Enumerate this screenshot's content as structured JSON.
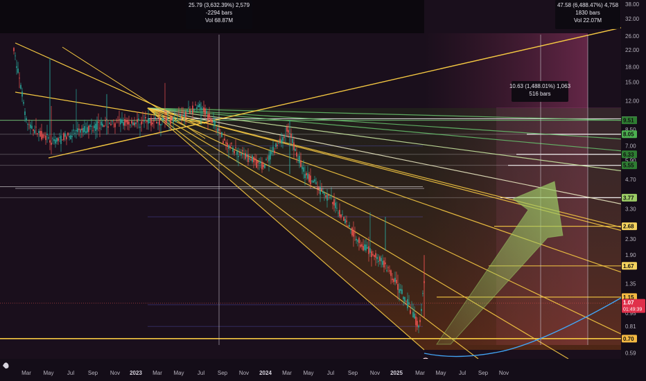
{
  "chart_data": {
    "type": "candlestick",
    "y_scale": "log",
    "ylim": [
      0.55,
      40
    ],
    "grid": false,
    "x_tick_labels": [
      "Mar",
      "May",
      "Jul",
      "Sep",
      "Nov",
      "2023",
      "Mar",
      "May",
      "Jul",
      "Sep",
      "Nov",
      "2024",
      "Mar",
      "May",
      "Jul",
      "Sep",
      "Nov",
      "2025",
      "Mar",
      "May",
      "Jul",
      "Sep",
      "Nov"
    ],
    "x_tick_bold": [
      "2023",
      "2024",
      "2025"
    ],
    "y_tick_labels": [
      "38.00",
      "32.00",
      "26.00",
      "22.00",
      "18.00",
      "15.00",
      "12.00",
      "9.52",
      "9.51",
      "8.50",
      "8.05",
      "7.00",
      "6.33",
      "5.90",
      "5.55",
      "4.70",
      "3.77",
      "3.30",
      "2.68",
      "2.30",
      "1.90",
      "1.67",
      "1.35",
      "1.15",
      "1.07",
      "0.95",
      "0.81",
      "0.70",
      "0.59"
    ],
    "y_tick_values": [
      38,
      32,
      26,
      22,
      18,
      15,
      12,
      9.52,
      9.51,
      8.5,
      8.05,
      7,
      6.33,
      5.9,
      5.55,
      4.7,
      3.77,
      3.3,
      2.68,
      2.3,
      1.9,
      1.67,
      1.35,
      1.15,
      1.07,
      0.95,
      0.81,
      0.7,
      0.59
    ],
    "marked_levels": [
      {
        "label": "9.52",
        "value": 9.52,
        "bg": "#ffffff"
      },
      {
        "label": "9.51",
        "value": 9.51,
        "bg": "#2e7d32"
      },
      {
        "label": "8.05",
        "value": 8.05,
        "bg": "#4caf50"
      },
      {
        "label": "6.33",
        "value": 6.33,
        "bg": "#2e7d32"
      },
      {
        "label": "5.55",
        "value": 5.55,
        "bg": "#2e7d32"
      },
      {
        "label": "3.77",
        "value": 3.77,
        "bg": "#9ccc65"
      },
      {
        "label": "2.68",
        "value": 2.68,
        "bg": "#f4d35e"
      },
      {
        "label": "1.67",
        "value": 1.67,
        "bg": "#f4d35e"
      },
      {
        "label": "1.15",
        "value": 1.15,
        "bg": "#f4b942"
      },
      {
        "label": "0.70",
        "value": 0.7,
        "bg": "#f4b942"
      }
    ],
    "last_price": {
      "value": "1.07",
      "countdown": "01:49:39",
      "bg": "#e0304a"
    },
    "measurements": [
      {
        "line1": "25.79 (3,632.39%) 2,579",
        "line2": "-2294 bars",
        "line3": "Vol 68.87M"
      },
      {
        "line1": "47.58 (6,488.47%) 4,758",
        "line2": "1830 bars",
        "line3": "Vol 22.07M"
      },
      {
        "line1": "10.63 (1,488.01%) 1,063",
        "line2": "516 bars",
        "line3": ""
      }
    ],
    "colors": {
      "background": "#140d18",
      "up": "#26a69a",
      "down": "#ef5350",
      "fan_yellow": "#f5c842",
      "fan_green": "#66bb6a",
      "projection_blue": "#42a5f5",
      "arrow": "#9ccc65"
    }
  }
}
